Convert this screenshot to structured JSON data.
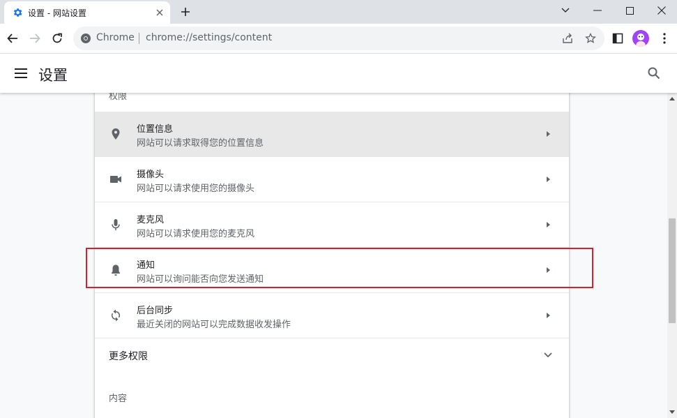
{
  "tab": {
    "title": "设置 - 网站设置",
    "favicon": "gear-icon"
  },
  "omnibox": {
    "site_label": "Chrome",
    "url": "chrome://settings/content"
  },
  "header": {
    "title": "设置"
  },
  "permissions": {
    "section_label": "权限",
    "items": [
      {
        "icon": "location-pin-icon",
        "title": "位置信息",
        "subtitle": "网站可以请求取得您的位置信息"
      },
      {
        "icon": "camera-icon",
        "title": "摄像头",
        "subtitle": "网站可以请求使用您的摄像头"
      },
      {
        "icon": "microphone-icon",
        "title": "麦克风",
        "subtitle": "网站可以请求使用您的麦克风"
      },
      {
        "icon": "bell-icon",
        "title": "通知",
        "subtitle": "网站可以询问能否向您发送通知"
      },
      {
        "icon": "sync-icon",
        "title": "后台同步",
        "subtitle": "最近关闭的网站可以完成数据收发操作"
      }
    ],
    "more_label": "更多权限"
  },
  "content_section": {
    "label": "内容"
  },
  "colors": {
    "accent": "#1a73e8",
    "highlight": "#d9202a",
    "avatar": "#a142f4"
  }
}
